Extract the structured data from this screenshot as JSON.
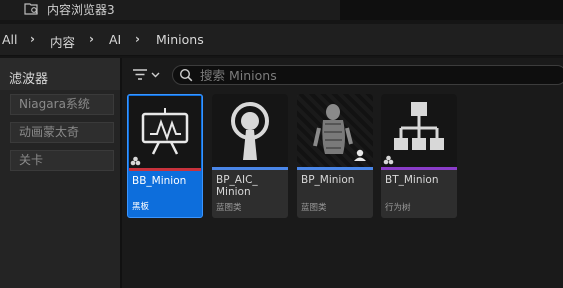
{
  "window": {
    "tab_title": "内容浏览器3"
  },
  "breadcrumb": {
    "items": [
      "All",
      "内容",
      "AI",
      "Minions"
    ]
  },
  "filters": {
    "title": "滤波器",
    "items": [
      "Niagara系统",
      "动画蒙太奇",
      "关卡"
    ]
  },
  "search": {
    "placeholder": "搜索 Minions",
    "value": ""
  },
  "assets": [
    {
      "name": "BB_Minion",
      "type": "黑板",
      "accent": "#c8323c",
      "selected": true,
      "icon": "blackboard-icon"
    },
    {
      "name": "BP_AIC_\nMinion",
      "type": "蓝图类",
      "accent": "#4a86e8",
      "selected": false,
      "icon": "ai-controller-icon"
    },
    {
      "name": "BP_Minion",
      "type": "蓝图类",
      "accent": "#4a86e8",
      "selected": false,
      "icon": "minion-mesh-thumbnail"
    },
    {
      "name": "BT_Minion",
      "type": "行为树",
      "accent": "#8a3cc8",
      "selected": false,
      "icon": "behavior-tree-icon"
    }
  ],
  "colors": {
    "selection": "#0d6edc",
    "background": "#1a1a1a"
  }
}
